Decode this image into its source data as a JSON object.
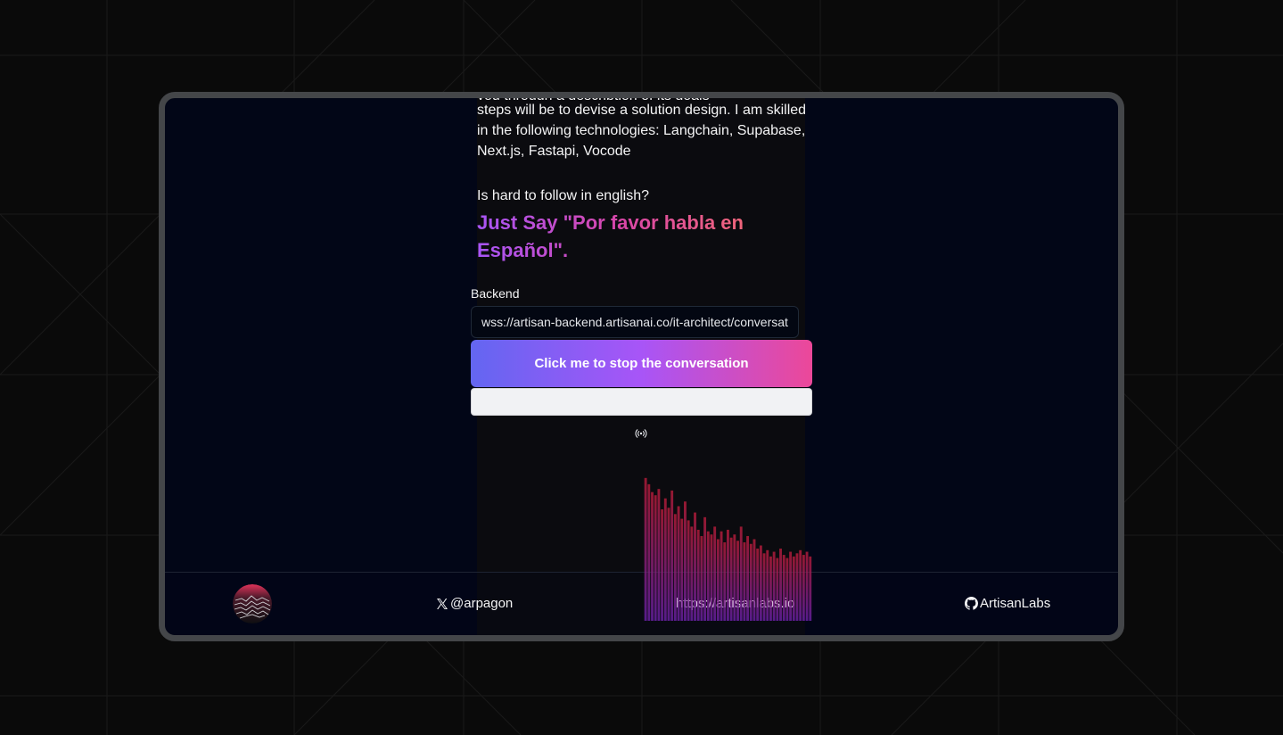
{
  "intro": {
    "cut_line": "you through a description of its goals",
    "lines": [
      "steps will be to devise a solution design. I am skilled",
      "in the following technologies: Langchain, Supabase,",
      "Next.js, Fastapi, Vocode"
    ],
    "question": "Is hard to follow in english?",
    "headline": "Just Say \"Por favor habla en Español\"."
  },
  "backend": {
    "label": "Backend",
    "value": "wss://artisan-backend.artisanai.co/it-architect/conversation"
  },
  "stop_button": {
    "label": "Click me to stop the conversation"
  },
  "status_icon": "broadcast-icon",
  "footer": {
    "twitter": {
      "icon": "x-logo-icon",
      "handle": "@arpagon"
    },
    "site": {
      "label": "https://artisanlabs.io"
    },
    "github": {
      "icon": "github-icon",
      "label": "ArtisanLabs"
    }
  },
  "colors": {
    "page_bg": "#0a0a0a",
    "device_frame": "#444649",
    "device_bg": "#020617",
    "button_gradient": [
      "#6366f1",
      "#a855f7",
      "#ec4899"
    ],
    "headline_gradient": [
      "#a855f7",
      "#d946a8",
      "#f97366"
    ],
    "visualizer_top": "#b91c3a",
    "visualizer_bottom": "#6b21a8"
  },
  "visualizer_levels": [
    0.0,
    0.91,
    0.87,
    0.82,
    0.8,
    0.84,
    0.71,
    0.78,
    0.72,
    0.83,
    0.68,
    0.73,
    0.65,
    0.76,
    0.64,
    0.6,
    0.69,
    0.58,
    0.54,
    0.66,
    0.57,
    0.55,
    0.6,
    0.52,
    0.57,
    0.5,
    0.58,
    0.53,
    0.55,
    0.51,
    0.6,
    0.5,
    0.54,
    0.49,
    0.52,
    0.46,
    0.48,
    0.43,
    0.45,
    0.41,
    0.44,
    0.4,
    0.46,
    0.42,
    0.4,
    0.44,
    0.41,
    0.43,
    0.45,
    0.42,
    0.44,
    0.41
  ]
}
